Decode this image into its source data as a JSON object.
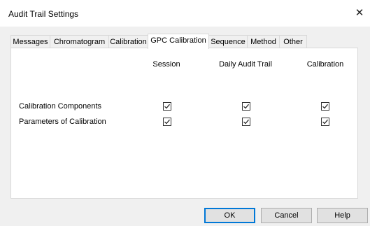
{
  "window": {
    "title": "Audit Trail Settings",
    "close_symbol": "✕"
  },
  "tabs": [
    {
      "label": "Messages",
      "active": false
    },
    {
      "label": "Chromatogram",
      "active": false
    },
    {
      "label": "Calibration",
      "active": false
    },
    {
      "label": "GPC Calibration",
      "active": true
    },
    {
      "label": "Sequence",
      "active": false
    },
    {
      "label": "Method",
      "active": false
    },
    {
      "label": "Other",
      "active": false
    }
  ],
  "columns": [
    "Session",
    "Daily Audit Trail",
    "Calibration"
  ],
  "rows": [
    {
      "label": "Calibration Components",
      "checked": [
        true,
        true,
        true
      ]
    },
    {
      "label": "Parameters of Calibration",
      "checked": [
        true,
        true,
        true
      ]
    }
  ],
  "buttons": {
    "ok": "OK",
    "cancel": "Cancel",
    "help": "Help"
  },
  "colors": {
    "accent": "#0078d7",
    "dialog_bg": "#f0f0f0",
    "panel_bg": "#ffffff"
  }
}
